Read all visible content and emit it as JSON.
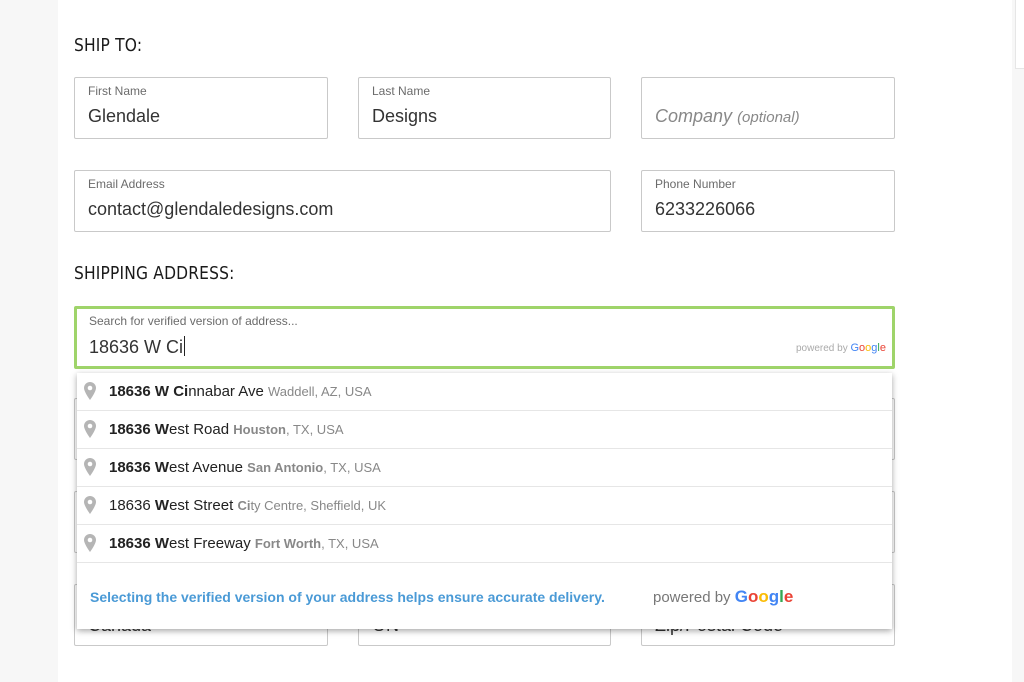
{
  "ship_to": {
    "title": "SHIP TO:",
    "first_name": {
      "label": "First Name",
      "value": "Glendale"
    },
    "last_name": {
      "label": "Last Name",
      "value": "Designs"
    },
    "company": {
      "placeholder": "Company",
      "placeholder_note": "(optional)"
    },
    "email": {
      "label": "Email Address",
      "value": "contact@glendaledesigns.com"
    },
    "phone": {
      "label": "Phone Number",
      "value": "6233226066"
    }
  },
  "shipping_address": {
    "title": "SHIPPING ADDRESS:",
    "search": {
      "label": "Search for verified version of address...",
      "value": "18636 W Ci",
      "powered_by": "powered by",
      "brand": "Google"
    },
    "suggestions": [
      {
        "bold": "18636 W Ci",
        "rest": "nnabar Ave",
        "secondary_bold": "",
        "secondary": "Waddell, AZ, USA"
      },
      {
        "bold": "18636 W",
        "rest": "est Road",
        "secondary_bold": "Houston",
        "secondary": ", TX, USA"
      },
      {
        "bold": "18636 W",
        "rest": "est Avenue",
        "secondary_bold": "San Antonio",
        "secondary": ", TX, USA"
      },
      {
        "bold_prefix": "18636 ",
        "bold": "W",
        "rest": "est Street",
        "secondary_bold": "Ci",
        "secondary": "ty Centre, Sheffield, UK"
      },
      {
        "bold": "18636 W",
        "rest": "est Freeway",
        "secondary_bold": "Fort Worth",
        "secondary": ", TX, USA"
      }
    ],
    "footer_note": "Selecting the verified version of your address helps ensure accurate delivery.",
    "footer_powered_by": "powered by",
    "footer_brand": "Google",
    "behind_fields": {
      "country": "Canada",
      "province": "ON",
      "zip_placeholder": "Zip/Postal Code"
    }
  },
  "colors": {
    "focus_border": "#9fd46a",
    "note_blue": "#4a9ad6",
    "google_blue": "#4285F4",
    "google_red": "#EA4335",
    "google_yellow": "#FBBC05",
    "google_green": "#34A853"
  },
  "icons": {
    "suggestion_marker": "map-pin-icon"
  }
}
